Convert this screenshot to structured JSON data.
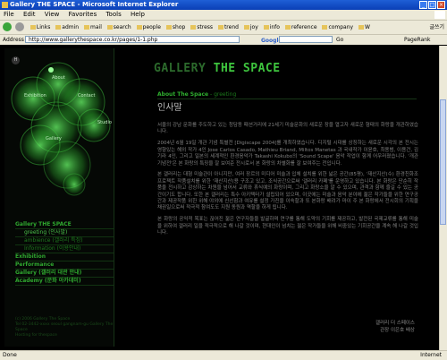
{
  "window": {
    "title": "Gallery THE SPACE - Microsoft Internet Explorer",
    "buttons": [
      "_",
      "□",
      "×"
    ]
  },
  "menubar": {
    "items": [
      "File",
      "Edit",
      "View",
      "Favorites",
      "Tools",
      "Help"
    ]
  },
  "toolbar": {
    "links": [
      "Links",
      "admin",
      "mail",
      "search",
      "people",
      "shop",
      "stress",
      "trend",
      "joy",
      "info",
      "reference",
      "company",
      "W"
    ],
    "right_label": "글쓰기"
  },
  "addressbar": {
    "label": "Address",
    "url": "http://www.gallerythespace.co.kr/pages/1-1.php",
    "google_label": "Google",
    "go_label": "Go",
    "pagerank_label": "PageRank"
  },
  "sidebar": {
    "menu_button": "H",
    "bubbles": [
      {
        "label": "About"
      },
      {
        "label": "Exhibition"
      },
      {
        "label": "Contact"
      },
      {
        "label": "Gallery"
      },
      {
        "label": "Studio"
      }
    ],
    "nav": [
      {
        "label": "Gallery THE SPACE",
        "level": 0
      },
      {
        "label": "greeting (인사말)",
        "level": 1,
        "active": true
      },
      {
        "label": "ambience (갤러리 특징)",
        "level": 1
      },
      {
        "label": "Information (이용안내)",
        "level": 1
      },
      {
        "label": "Exhibition",
        "level": 0
      },
      {
        "label": "Performance",
        "level": 0
      },
      {
        "label": "Gallery (갤러리 대관 안내)",
        "level": 0
      },
      {
        "label": "Academy (문화 아카데미)",
        "level": 0
      }
    ],
    "footer": [
      "(c) 2006 Gallery The Space",
      "Tel 02-3442-xxxx seoul gangnam-gu Gallery The Space",
      "Hosting for thespace"
    ]
  },
  "content": {
    "logo_g": "GALLERY",
    "logo_ts": " THE SPACE",
    "section_label": "About The Space",
    "section_sub": " - greeting",
    "title": "인사말",
    "paragraphs": [
      "서울의 강남 문화를 주도하고 있는 청담동 패션거리에 21세기 미술문화의 새로운 장을 열고자 새로운 형태의 화랑을 개관하였습니다.",
      "2004년 6월 19일 개관 기념 특별전 [Digiscape 2004]를 개최하였습니다. 디지털 시대를 상징하는 새로운 시각의 본 전시는 영향있는 해외 작가 4인 Jose Carlos Casado, Mathieu Briand, Miltos Manetas 과 국내작가 이윤호, 최용범, 이용건, 김기라 4인, 그리고 일본의 세계적인 환경음악가 Takashi Kokubo의 'Sound Scape' 음악 작업이 함께 어우러졌습니다. '개관기념전'은 본 화랑의 특징을 잘 보여준 전시로서 본 화랑의 차별화를 잘 보여주는 전입니다.",
      "본 갤러리는 대형 미술관이 아니지만, 여러 장르의 미디어 미술과 입체 설치를 위한 넓은 공간(85평), '재산지산(수) 환경친화조 프로젝트 작품설치를 위한 '재산지산(용 구조고 있고, 조식공간으로써 '갤러리 카페'를 운영하고 있습니다. 본 화랑은 단순히 작품을 전시하고 감상하는 차원을 넘어서 교류와 휴식예의 화랑이며, 그리고 화랑소을 알 수 있으며, 관객과 함께 즐길 수 있는 공간이기도 합니다. 또한 본 갤러리는 특수 아키텍터가 설립되어 있으며, 이곳에는 미술과 음악 분야에 젊은 작가들을 위한 연구공간과 제공작품 위한 위해 야외에 신선함과 여유를 설정 가진을 이숙할과 또 본화랑 배려가 마이 주 본 화랑에서 전시회의 기획을 채권일으로써 적극적 참여도도 지원 동원과 역할을 하게 됩니다.",
      "본 화랑의 공익적 목표는 끊어진 젊은 연구자들을 발굴하며 연구를 통해 도약의 기회를 제공하고, 발전된 국제교류를 통해 미술을 위하여 갤러리 일을 적극적으로 해 나갈 것이며, 현대인이 넘치는 젊은 작가들을 위해 비중있는 기회공간을 계속 해 나갈 것입니다."
    ],
    "signature": [
      "갤러리 더 스페이스",
      "관장 이은호 배상"
    ]
  },
  "statusbar": {
    "left": "Done",
    "right": "Internet"
  },
  "colors": {
    "accent_green": "#3ec43e",
    "title_blue": "#0a3fb6"
  }
}
